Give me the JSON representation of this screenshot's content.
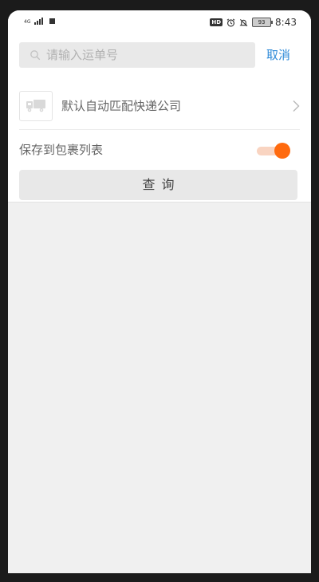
{
  "status_bar": {
    "signal_label": "4G",
    "hd_badge": "HD",
    "battery_level": "93",
    "time": "8:43"
  },
  "search": {
    "placeholder": "请输入运单号",
    "value": "",
    "cancel_label": "取消"
  },
  "company": {
    "label": "默认自动匹配快递公司",
    "icon": "truck-icon"
  },
  "save_option": {
    "label": "保存到包裹列表",
    "enabled": true,
    "accent_color": "#ff6a0e"
  },
  "query_button": {
    "label": "查询"
  },
  "colors": {
    "cancel_link": "#2d8ad8",
    "background": "#f0f0f0"
  }
}
